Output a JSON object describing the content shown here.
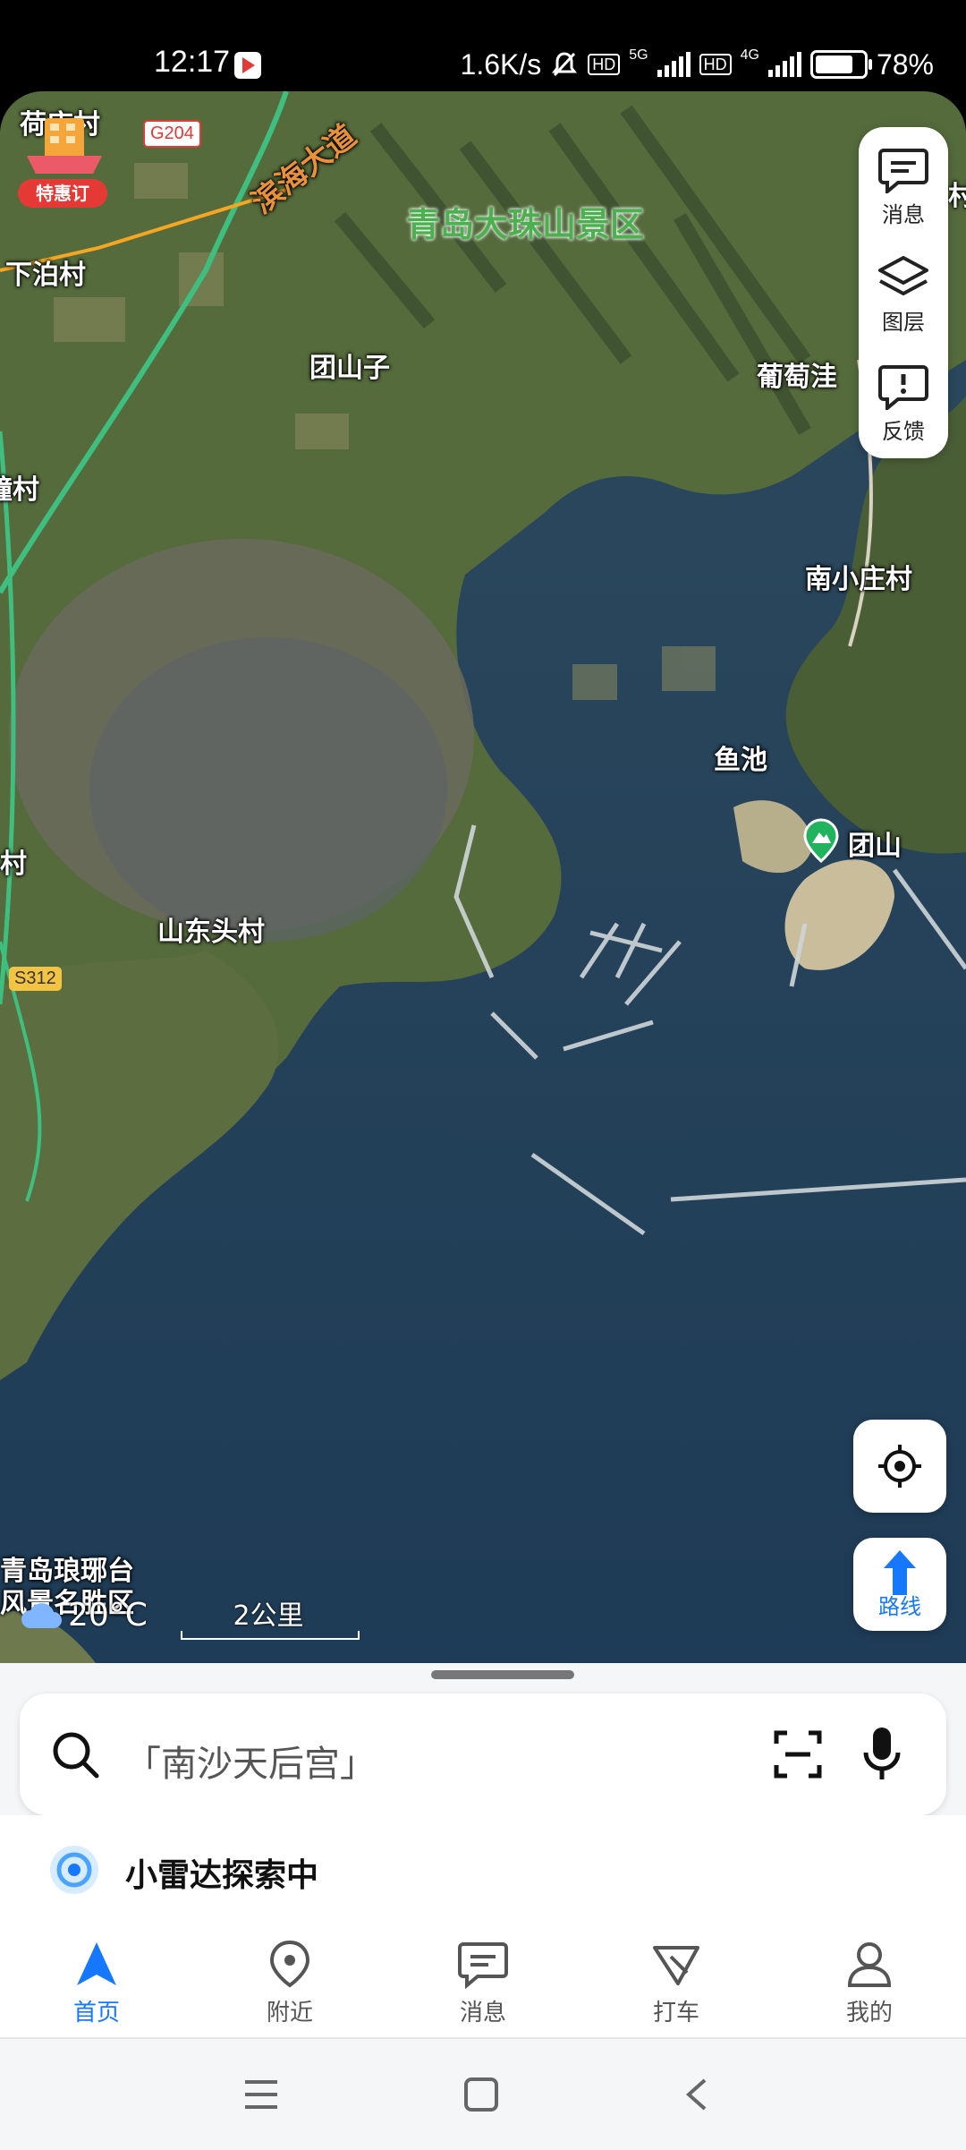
{
  "status_bar": {
    "time": "12:17",
    "speed": "1.6K/s",
    "net1": "5G",
    "net2": "4G",
    "hd": "HD",
    "battery": "78%"
  },
  "promo_badge": {
    "label": "特惠订"
  },
  "map": {
    "places": [
      "荷店村",
      "下泊村",
      "团山子",
      "葡萄洼",
      "南小庄村",
      "鱼池",
      "团山",
      "山东头村",
      "青岛琅琊台",
      "风景名胜区",
      "疃村",
      "村",
      "村"
    ],
    "scenic_area": "青岛大珠山景区",
    "road_name": "滨海大道",
    "road_badges": [
      "G204",
      "S312"
    ],
    "scale_label": "2公里",
    "weather": "20°C"
  },
  "right_panel": {
    "messages": "消息",
    "layers": "图层",
    "feedback": "反馈"
  },
  "route_button": {
    "label": "路线"
  },
  "search": {
    "placeholder": "「南沙天后宫」"
  },
  "radar": {
    "label": "小雷达探索中"
  },
  "tabs": [
    {
      "label": "首页"
    },
    {
      "label": "附近"
    },
    {
      "label": "消息"
    },
    {
      "label": "打车"
    },
    {
      "label": "我的"
    }
  ],
  "colors": {
    "accent": "#1677ff",
    "scenic": "#4caf50",
    "promo": "#e53935"
  }
}
